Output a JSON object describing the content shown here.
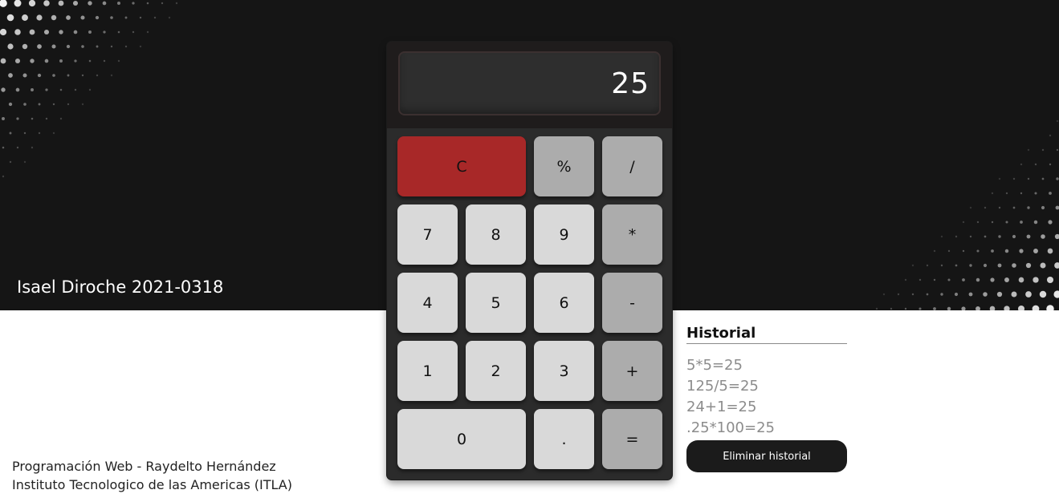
{
  "author": "Isael Diroche 2021-0318",
  "display": {
    "value": "25"
  },
  "keys": {
    "clear": "C",
    "percent": "%",
    "divide": "/",
    "seven": "7",
    "eight": "8",
    "nine": "9",
    "multiply": "*",
    "four": "4",
    "five": "5",
    "six": "6",
    "minus": "-",
    "one": "1",
    "two": "2",
    "three": "3",
    "plus": "+",
    "zero": "0",
    "dot": ".",
    "equals": "="
  },
  "history": {
    "title": "Historial",
    "items": [
      "5*5=25",
      "125/5=25",
      "24+1=25",
      ".25*100=25"
    ],
    "clear_label": "Eliminar historial"
  },
  "footer": {
    "line1": "Programación Web - Raydelto Hernández",
    "line2": "Instituto Tecnologico de las Americas (ITLA)"
  },
  "colors": {
    "hero_bg": "#151515",
    "clear_key": "#a82828",
    "number_key": "#d9d9d9",
    "operator_key": "#acacac",
    "calculator_body": "#2b2b2b"
  }
}
